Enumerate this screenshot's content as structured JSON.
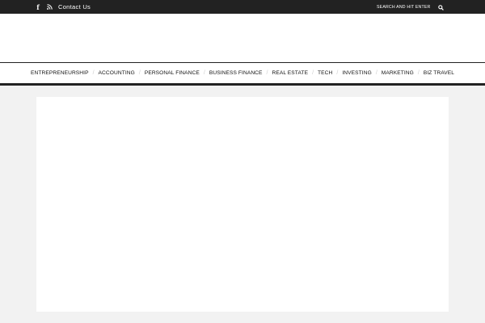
{
  "topbar": {
    "social": [
      {
        "icon": "facebook-icon",
        "glyph": "f"
      },
      {
        "icon": "rss-icon"
      }
    ],
    "contact_label": "Contact Us",
    "search": {
      "placeholder": "SEARCH AND HIT ENTER...",
      "icon": "search-icon"
    }
  },
  "nav": {
    "items": [
      {
        "label": "ENTREPRENEURSHIP"
      },
      {
        "label": "ACCOUNTING"
      },
      {
        "label": "PERSONAL FINANCE"
      },
      {
        "label": "BUSINESS FINANCE"
      },
      {
        "label": "REAL ESTATE"
      },
      {
        "label": "TECH"
      },
      {
        "label": "INVESTING"
      },
      {
        "label": "MARKETING"
      },
      {
        "label": "BIZ TRAVEL"
      }
    ],
    "separator": "/"
  },
  "colors": {
    "topbar_bg": "#222222",
    "page_bg": "#f2f2f2",
    "nav_border": "#222222"
  }
}
